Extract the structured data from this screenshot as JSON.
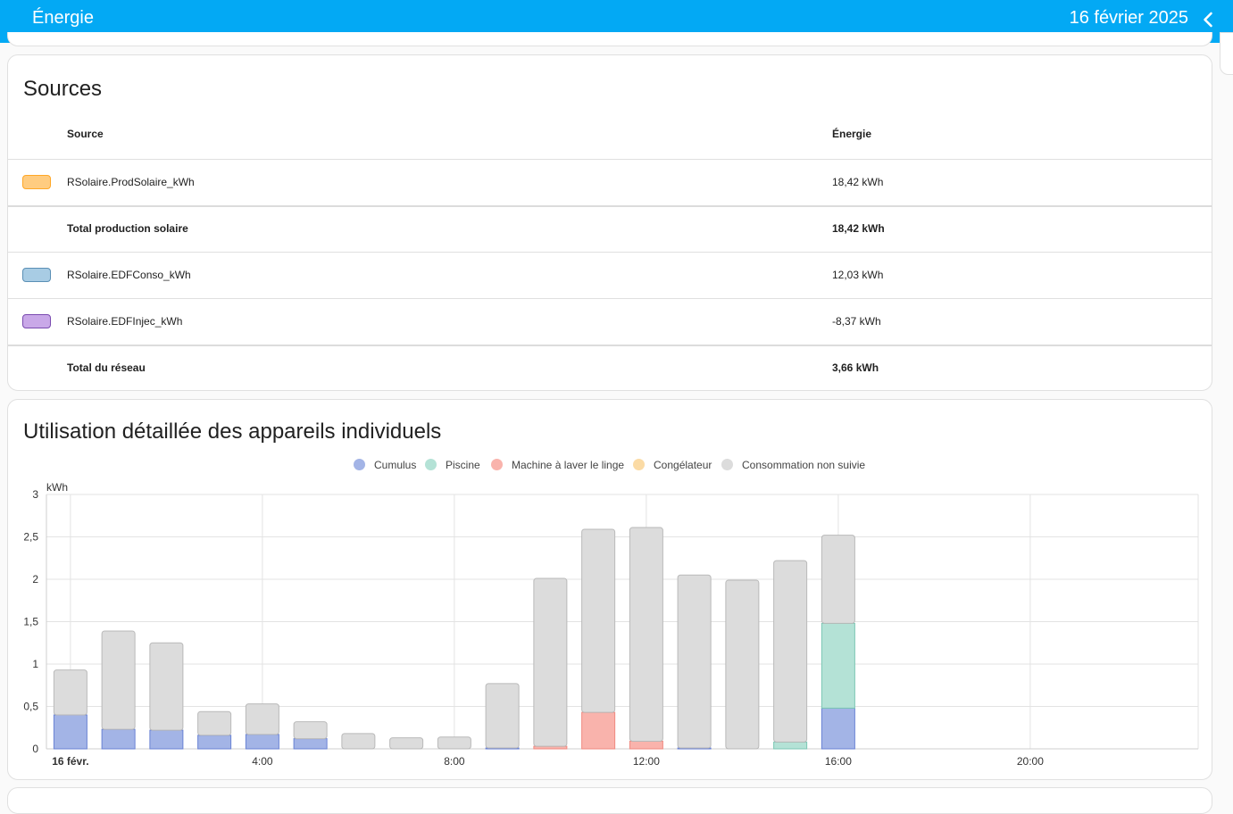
{
  "header": {
    "title": "Énergie",
    "date": "16 février 2025"
  },
  "sources": {
    "title": "Sources",
    "columns": {
      "source": "Source",
      "energy": "Énergie"
    },
    "rows": [
      {
        "name": "RSolaire.ProdSolaire_kWh",
        "value": "18,42 kWh",
        "swatch_bg": "#ffcc80",
        "swatch_border": "#ffa726"
      },
      {
        "name": "Total production solaire",
        "value": "18,42 kWh",
        "total": true
      },
      {
        "name": "RSolaire.EDFConso_kWh",
        "value": "12,03 kWh",
        "swatch_bg": "#a8cce4",
        "swatch_border": "#5a8fb5"
      },
      {
        "name": "RSolaire.EDFInjec_kWh",
        "value": "-8,37 kWh",
        "swatch_bg": "#c9a8e8",
        "swatch_border": "#7a4bb0"
      },
      {
        "name": "Total du réseau",
        "value": "3,66 kWh",
        "total": true
      }
    ]
  },
  "devices": {
    "title": "Utilisation détaillée des appareils individuels"
  },
  "chart_data": {
    "type": "bar",
    "stacked": true,
    "ylabel": "kWh",
    "ylim": [
      0,
      3
    ],
    "yticks": [
      "0",
      "0,5",
      "1",
      "1,5",
      "2",
      "2,5",
      "3"
    ],
    "xticks": [
      "16 févr.",
      "4:00",
      "8:00",
      "12:00",
      "16:00",
      "20:00"
    ],
    "hours": [
      0,
      1,
      2,
      3,
      4,
      5,
      6,
      7,
      8,
      9,
      10,
      11,
      12,
      13,
      14,
      15,
      16
    ],
    "legend_position": "top",
    "grid": true,
    "series": [
      {
        "name": "Cumulus",
        "color": "#a3b4e6",
        "stroke": "#6a82d4",
        "values": [
          0.4,
          0.23,
          0.22,
          0.16,
          0.17,
          0.12,
          0,
          0,
          0,
          0.01,
          0,
          0,
          0,
          0.01,
          0,
          0,
          0.48
        ]
      },
      {
        "name": "Piscine",
        "color": "#b4e2d6",
        "stroke": "#7cc7b4",
        "values": [
          0,
          0,
          0,
          0,
          0,
          0,
          0,
          0,
          0,
          0,
          0,
          0,
          0,
          0,
          0,
          0.08,
          1.0
        ]
      },
      {
        "name": "Machine à laver le linge",
        "color": "#f9b3ac",
        "stroke": "#ef8a80",
        "values": [
          0,
          0,
          0,
          0,
          0,
          0,
          0,
          0,
          0,
          0,
          0.03,
          0.43,
          0.09,
          0,
          0,
          0,
          0
        ]
      },
      {
        "name": "Congélateur",
        "color": "#fbdba5",
        "stroke": "#f5c26b",
        "values": [
          0,
          0,
          0,
          0,
          0,
          0,
          0,
          0,
          0,
          0,
          0,
          0,
          0,
          0,
          0,
          0,
          0
        ]
      },
      {
        "name": "Consommation non suivie",
        "color": "#dcdcdc",
        "stroke": "#b9b9b9",
        "values": [
          0.53,
          1.16,
          1.03,
          0.28,
          0.36,
          0.2,
          0.18,
          0.13,
          0.14,
          0.76,
          1.98,
          2.16,
          2.52,
          2.04,
          1.99,
          2.14,
          1.04
        ]
      }
    ]
  }
}
